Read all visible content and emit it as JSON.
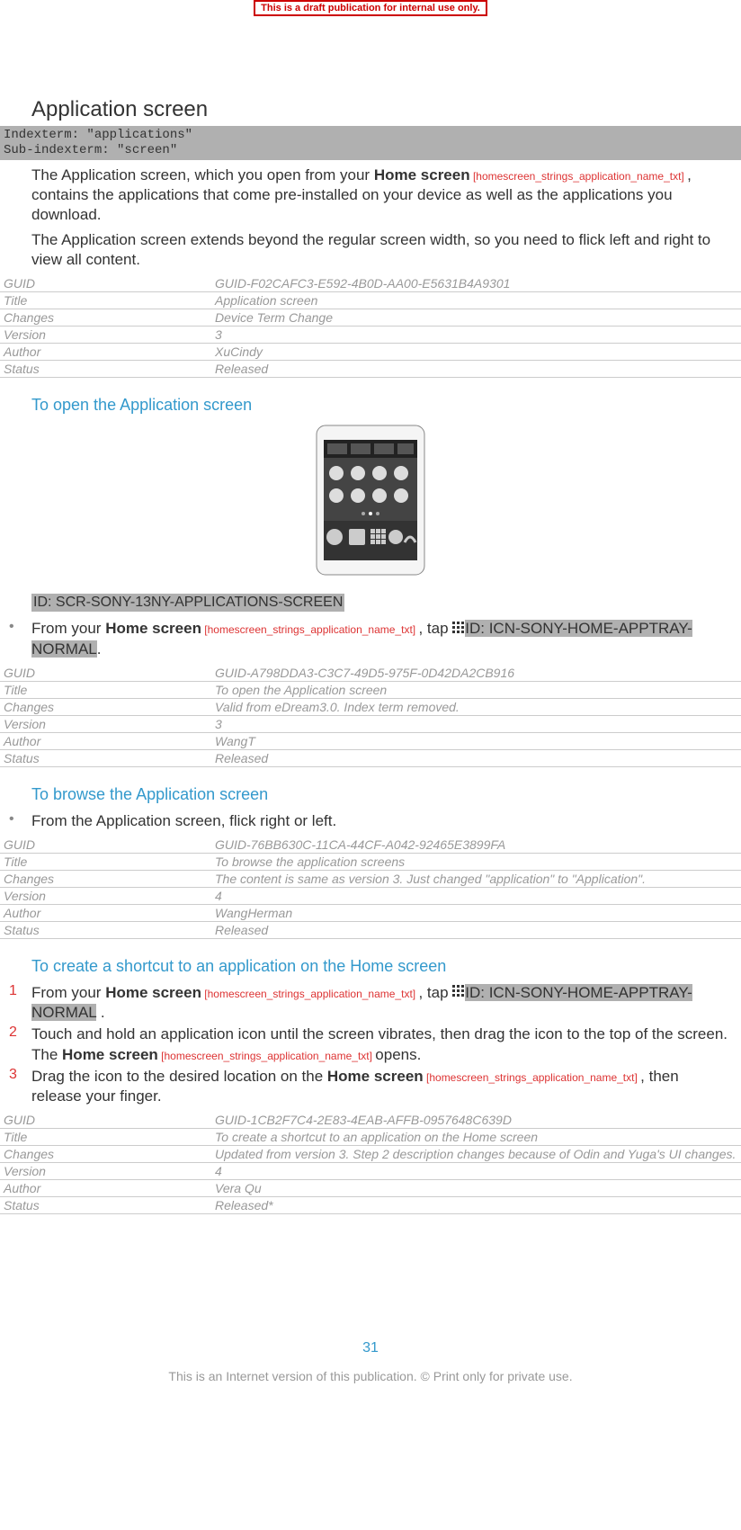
{
  "banner": "This is a draft publication for internal use only.",
  "heading": "Application screen",
  "indexterm_l1": "Indexterm: \"applications\"",
  "indexterm_l2": "Sub-indexterm: \"screen\"",
  "p1_a": "The Application screen, which you open from your ",
  "p1_home": "Home screen",
  "p1_ref": " [homescreen_strings_application_name_txt] ",
  "p1_b": ", contains the applications that come pre-installed on your device as well as the applications you download.",
  "p2": "The Application screen extends beyond the regular screen width, so you need to flick left and right to view all content.",
  "table1": {
    "guid_k": "GUID",
    "guid_v": "GUID-F02CAFC3-E592-4B0D-AA00-E5631B4A9301",
    "title_k": "Title",
    "title_v": "Application screen",
    "changes_k": "Changes",
    "changes_v": "Device Term Change",
    "version_k": "Version",
    "version_v": "3",
    "author_k": "Author",
    "author_v": "XuCindy",
    "status_k": "Status",
    "status_v": "Released"
  },
  "sec1_heading": "To open the Application screen",
  "sec1_id": "ID: SCR-SONY-13NY-APPLICATIONS-SCREEN",
  "sec1_bullet_a": "From your ",
  "sec1_bullet_home": "Home screen",
  "sec1_bullet_ref": " [homescreen_strings_application_name_txt] ",
  "sec1_bullet_b": ", tap ",
  "sec1_icn": "ID: ICN-SONY-HOME-APPTRAY-NORMAL",
  "sec1_period": ".",
  "table2": {
    "guid_v": "GUID-A798DDA3-C3C7-49D5-975F-0D42DA2CB916",
    "title_v": "To open the Application screen",
    "changes_v": "Valid from eDream3.0. Index term removed.",
    "version_v": "3",
    "author_v": "WangT",
    "status_v": "Released"
  },
  "sec2_heading": "To browse the Application screen",
  "sec2_bullet": "From the Application screen, flick right or left.",
  "table3": {
    "guid_v": "GUID-76BB630C-11CA-44CF-A042-92465E3899FA",
    "title_v": "To browse the application screens",
    "changes_v": "The content is same as version 3. Just changed \"application\" to \"Application\".",
    "version_v": "4",
    "author_v": "WangHerman",
    "status_v": "Released"
  },
  "sec3_heading": "To create a shortcut to an application on the Home screen",
  "sec3_s1_a": "From your ",
  "sec3_s1_home": "Home screen",
  "sec3_s1_ref": " [homescreen_strings_application_name_txt] ",
  "sec3_s1_b": ", tap ",
  "sec3_s1_icn": "ID: ICN-SONY-HOME-APPTRAY-NORMAL",
  "sec3_s1_period": " .",
  "sec3_s2_a": "Touch and hold an application icon until the screen vibrates, then drag the icon to the top of the screen. The ",
  "sec3_s2_home": "Home screen",
  "sec3_s2_ref": " [homescreen_strings_application_name_txt] ",
  "sec3_s2_b": "opens.",
  "sec3_s3_a": "Drag the icon to the desired location on the ",
  "sec3_s3_home": "Home screen",
  "sec3_s3_ref": " [homescreen_strings_application_name_txt] ",
  "sec3_s3_b": ", then release your finger.",
  "table4": {
    "guid_v": "GUID-1CB2F7C4-2E83-4EAB-AFFB-0957648C639D",
    "title_v": "To create a shortcut to an application on the Home screen",
    "changes_v": "Updated from version 3. Step 2 description changes because of Odin and Yuga's UI changes.",
    "version_v": "4",
    "author_v": "Vera Qu",
    "status_v": "Released*"
  },
  "labels": {
    "guid": "GUID",
    "title": "Title",
    "changes": "Changes",
    "version": "Version",
    "author": "Author",
    "status": "Status"
  },
  "page_num": "31",
  "footer": "This is an Internet version of this publication. © Print only for private use."
}
